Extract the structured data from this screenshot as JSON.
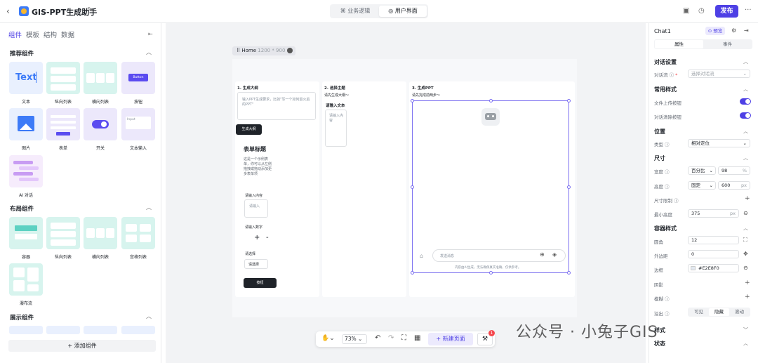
{
  "app": {
    "title": "GIS-PPT生成助手",
    "publish_label": "发布"
  },
  "modes": [
    "业务逻辑",
    "用户界面"
  ],
  "left": {
    "tabs": [
      "组件",
      "模板",
      "结构",
      "数据"
    ],
    "sections": {
      "recommended": "推荐组件",
      "layout": "布局组件",
      "display": "展示组件"
    },
    "recommended": [
      {
        "label": "文本",
        "thumb_text": "Text"
      },
      {
        "label": "纵向列表"
      },
      {
        "label": "横向列表"
      },
      {
        "label": "按钮",
        "thumb_text": "Button"
      },
      {
        "label": "图片"
      },
      {
        "label": "表单"
      },
      {
        "label": "开关"
      },
      {
        "label": "文本输入",
        "thumb_text": "Input"
      },
      {
        "label": "AI 对话"
      }
    ],
    "layout": [
      {
        "label": "容器"
      },
      {
        "label": "纵向列表"
      },
      {
        "label": "横向列表"
      },
      {
        "label": "宫格列表"
      },
      {
        "label": "瀑布流"
      }
    ],
    "add_label": "添加组件"
  },
  "canvas": {
    "page_name": "Home",
    "page_size": "1200 * 900",
    "card1": {
      "title": "1. 生成大纲",
      "input_placeholder": "输入PPT生成要求，比如\"写一个如何退火后的PPT\"",
      "gen_button": "生成大纲",
      "form_title": "表单标题",
      "form_desc": "这是一个示例表单，你可以从左侧拖拽或拖动添加更多表单项",
      "field1_label": "请输入内容",
      "field1_placeholder": "请输入",
      "field2_label": "请输入数字",
      "field3_label": "请选择",
      "field3_placeholder": "请选择",
      "submit": "按钮"
    },
    "card2": {
      "title": "2. 选择主题",
      "hint": "请先生成大纲～",
      "text_label": "请输入文本",
      "text_placeholder": "请输入内容"
    },
    "card3": {
      "title": "3. 生成PPT",
      "hint": "请先完成前两步～",
      "chat_placeholder": "发送消息",
      "disclaimer": "内容由AI生成，无法确保真实准确，仅供参考。"
    }
  },
  "bottombar": {
    "zoom": "73%",
    "new_page": "新建页面",
    "badge": "1"
  },
  "right": {
    "component_name": "Chat1",
    "preview_label": "预览",
    "tabs": [
      "属性",
      "事件"
    ],
    "dialog_section": "对话设置",
    "dialog_flow_label": "对话流",
    "dialog_flow_placeholder": "选择对话流",
    "common_style": "常用样式",
    "file_upload": "文件上传按钮",
    "clear_btn": "对话清除按钮",
    "position_section": "位置",
    "type_label": "类型",
    "type_value": "相对定位",
    "size_section": "尺寸",
    "width_label": "宽度",
    "width_mode": "百分比",
    "width_value": "98",
    "width_unit": "%",
    "height_label": "高度",
    "height_mode": "固定",
    "height_value": "600",
    "height_unit": "px",
    "size_limit": "尺寸限制",
    "min_height_label": "最小高度",
    "min_height_value": "375",
    "min_height_unit": "px",
    "container_section": "容器样式",
    "radius_label": "圆角",
    "radius_value": "12",
    "margin_label": "外边距",
    "margin_value": "0",
    "border_label": "边框",
    "border_value": "#E2E8F0",
    "shadow_label": "阴影",
    "blur_label": "模糊",
    "overflow_label": "溢出",
    "overflow_opts": [
      "可见",
      "隐藏",
      "滚动"
    ],
    "style_label": "样式",
    "state_label": "状态"
  },
  "watermark": "公众号 · 小兔子GIS"
}
